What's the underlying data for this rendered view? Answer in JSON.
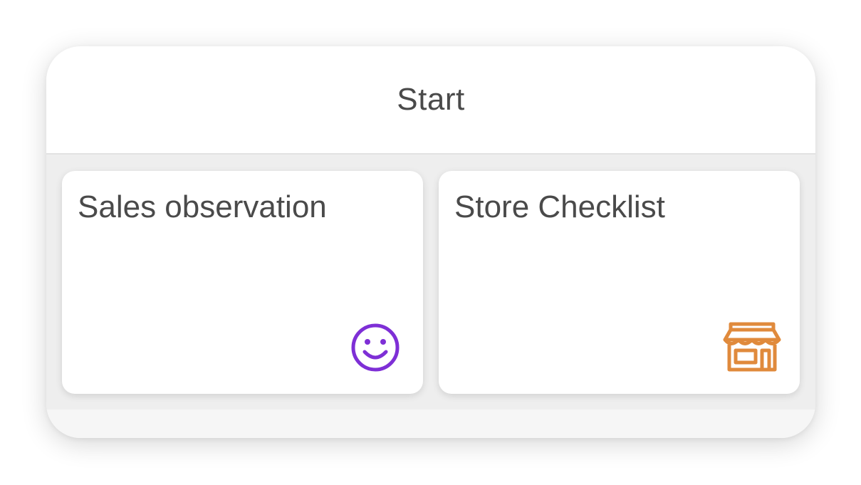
{
  "header": {
    "title": "Start"
  },
  "cards": [
    {
      "label": "Sales observation",
      "icon": "smiley-icon",
      "icon_color": "#7e2fd6"
    },
    {
      "label": "Store Checklist",
      "icon": "store-icon",
      "icon_color": "#e08a3c"
    }
  ]
}
